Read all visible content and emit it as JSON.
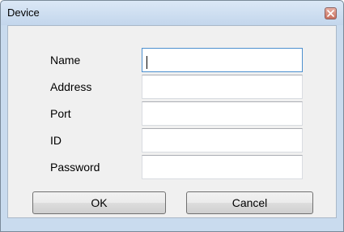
{
  "window": {
    "title": "Device"
  },
  "form": {
    "fields": [
      {
        "label": "Name",
        "value": ""
      },
      {
        "label": "Address",
        "value": ""
      },
      {
        "label": "Port",
        "value": ""
      },
      {
        "label": "ID",
        "value": ""
      },
      {
        "label": "Password",
        "value": ""
      }
    ]
  },
  "buttons": {
    "ok_label": "OK",
    "cancel_label": "Cancel"
  },
  "icons": {
    "close": "close-icon"
  },
  "colors": {
    "titlebar": "#c9dbee",
    "close_button": "#c8705e",
    "focus_border": "#4d90cf"
  }
}
